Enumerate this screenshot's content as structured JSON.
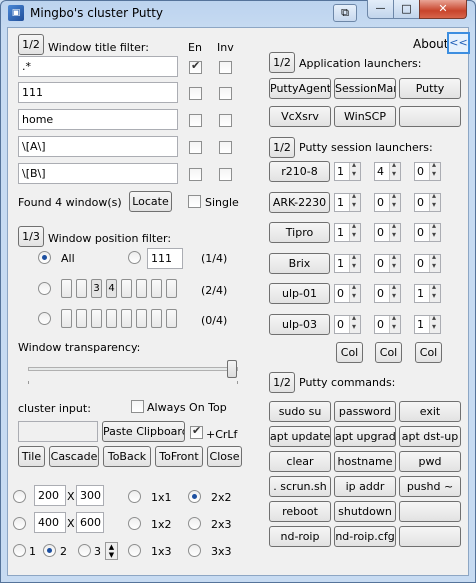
{
  "window": {
    "title": "Mingbo's cluster Putty",
    "close": "✕",
    "minimize": "—",
    "maximize": "□"
  },
  "toggle": "1/2",
  "filter": {
    "label": "Window title filter:",
    "col_en": "En",
    "col_inv": "Inv",
    "rows": [
      {
        "value": ".*",
        "en": true,
        "inv": false
      },
      {
        "value": "111",
        "en": false,
        "inv": false
      },
      {
        "value": "home",
        "en": false,
        "inv": false
      },
      {
        "value": "\\[A\\]",
        "en": false,
        "inv": false
      },
      {
        "value": "\\[B\\]",
        "en": false,
        "inv": false
      }
    ]
  },
  "found": "Found 4 window(s)",
  "locate": "Locate",
  "single": "Single",
  "position": {
    "toggle": "1/3",
    "label": "Window position filter:",
    "all": "All",
    "value": "111",
    "counts": [
      "(1/4)",
      "(2/4)",
      "(0/4)"
    ],
    "cells_row2": [
      "",
      "",
      "3",
      "4",
      "",
      "",
      "",
      ""
    ]
  },
  "transparency": {
    "label": "Window transparency:",
    "level": 0.97
  },
  "cluster": {
    "label": "cluster input:",
    "always_on_top": "Always On Top",
    "paste": "Paste Clipboard",
    "crlf": "+CrLf"
  },
  "arrange": [
    "Tile",
    "Cascade",
    "ToBack",
    "ToFront",
    "Close"
  ],
  "layout": {
    "w1": "200",
    "h1": "300",
    "w2": "400",
    "h2": "600",
    "x": "X",
    "grid": [
      "1x1",
      "2x2",
      "1x2",
      "2x3",
      "1x3",
      "3x3"
    ],
    "cols": [
      "1",
      "2",
      "3"
    ]
  },
  "about": "About",
  "collapse": "<<",
  "apps": {
    "toggle": "1/2",
    "label": "Application launchers:",
    "buttons": [
      "PuttyAgent",
      "SessionMan",
      "Putty",
      "VcXsrv",
      "WinSCP",
      ""
    ]
  },
  "sessions": {
    "toggle": "1/2",
    "label": "Putty session launchers:",
    "rows": [
      {
        "name": "r210-8",
        "a": "1",
        "b": "4",
        "c": "0"
      },
      {
        "name": "ARK-2230",
        "a": "1",
        "b": "0",
        "c": "0"
      },
      {
        "name": "Tipro",
        "a": "1",
        "b": "0",
        "c": "0"
      },
      {
        "name": "Brix",
        "a": "1",
        "b": "0",
        "c": "0"
      },
      {
        "name": "ulp-01",
        "a": "0",
        "b": "0",
        "c": "1"
      },
      {
        "name": "ulp-03",
        "a": "0",
        "b": "0",
        "c": "1"
      }
    ],
    "col": "Col"
  },
  "commands": {
    "toggle": "1/2",
    "label": "Putty commands:",
    "buttons": [
      "sudo su",
      "password",
      "exit",
      "apt update",
      "apt upgrade",
      "apt dst-up",
      "clear",
      "hostname",
      "pwd",
      ". scrun.sh",
      "ip addr",
      "pushd ~",
      "reboot",
      "shutdown",
      "",
      "nd-roip",
      "nd-roip.cfg",
      ""
    ]
  }
}
